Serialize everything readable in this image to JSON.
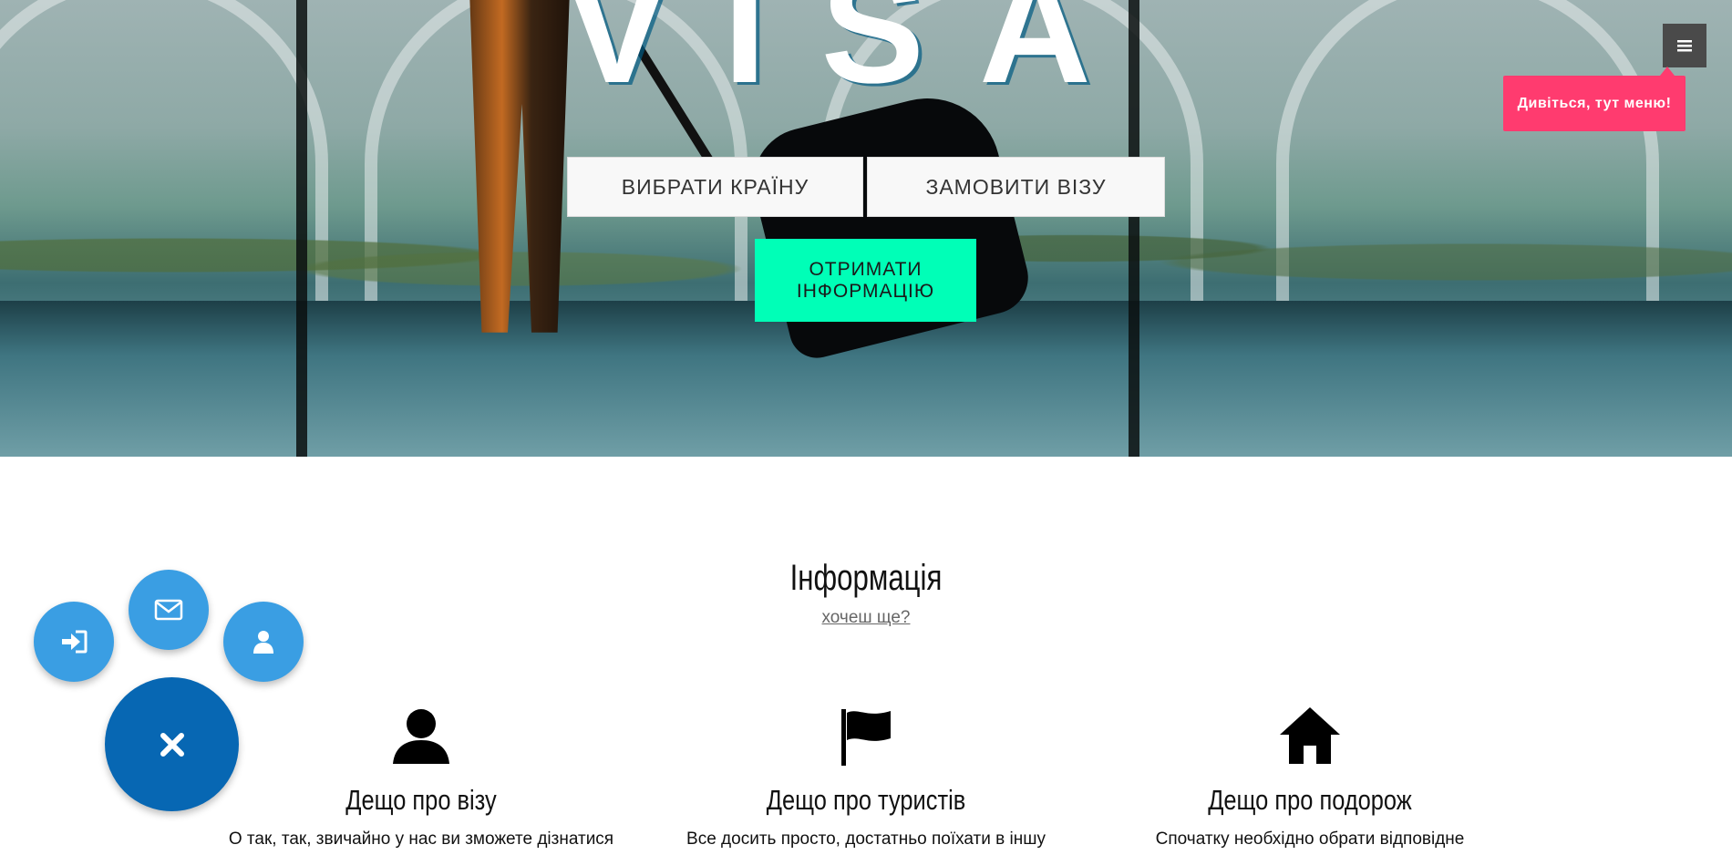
{
  "hero": {
    "title": "VISA",
    "buttons": {
      "choose_country": "ВИБРАТИ КРАЇНУ",
      "order_visa": "ЗАМОВИТИ ВІЗУ",
      "get_info": "ОТРИМАТИ ІНФОРМАЦІЮ"
    }
  },
  "menu": {
    "toggle_icon": "hamburger-icon",
    "tooltip": "Дивіться, тут меню!"
  },
  "info": {
    "title": "Інформація",
    "subtitle": "хочеш ще?",
    "features": [
      {
        "icon": "user-icon",
        "title": "Дещо про візу",
        "text": "О так, так, звичайно у нас ви зможете дізнатися"
      },
      {
        "icon": "flag-icon",
        "title": "Дещо про туристів",
        "text": "Все досить просто, достатньо поїхати в іншу"
      },
      {
        "icon": "home-icon",
        "title": "Дещо про подорож",
        "text": "Спочатку необхідно обрати відповідне"
      }
    ]
  },
  "fab": {
    "items": [
      "sign-in-icon",
      "envelope-icon",
      "user-icon"
    ],
    "main_icon": "close-icon"
  },
  "colors": {
    "info_button": "#00ffb7",
    "tooltip": "#ff3b6f",
    "fab_small": "#3a9ee3",
    "fab_main": "#0767b3"
  }
}
